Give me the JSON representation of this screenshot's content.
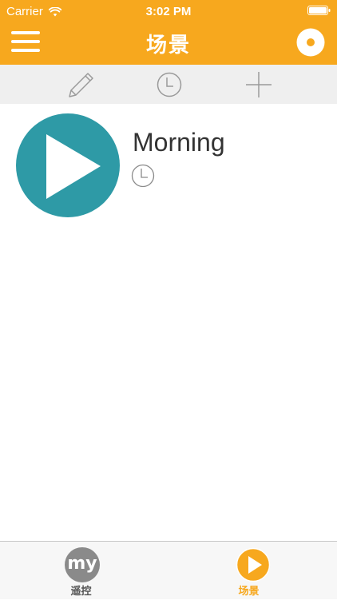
{
  "status_bar": {
    "carrier": "Carrier",
    "time": "3:02 PM"
  },
  "nav": {
    "title": "场景",
    "left_icon": "hamburger-menu-icon",
    "right_icon": "record-icon"
  },
  "toolbar": {
    "items": [
      {
        "icon": "pencil-icon"
      },
      {
        "icon": "clock-icon"
      },
      {
        "icon": "plus-icon"
      }
    ]
  },
  "scenes": [
    {
      "name": "Morning",
      "play_icon": "play-icon",
      "timer_icon": "clock-icon"
    }
  ],
  "tabs": [
    {
      "label": "遥控",
      "icon_text": "my",
      "active": false
    },
    {
      "label": "场景",
      "icon": "play-icon",
      "active": true
    }
  ],
  "colors": {
    "accent": "#F7A81E",
    "play_circle": "#2E9AA6",
    "toolbar_bg": "#EFEFEF",
    "tab_inactive_icon": "#8A8A8A"
  }
}
